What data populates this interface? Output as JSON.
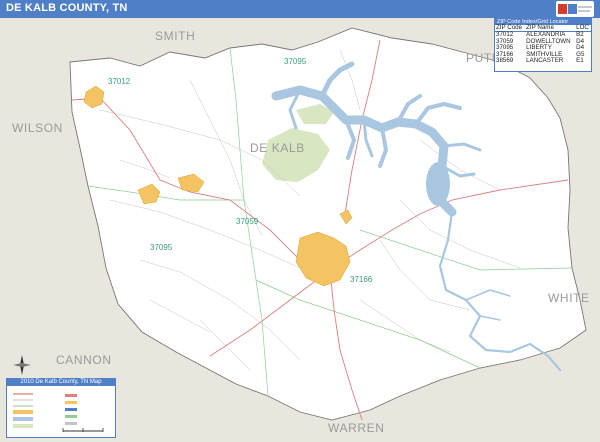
{
  "header": {
    "title": "DE KALB COUNTY, TN"
  },
  "map": {
    "county_name": "DE KALB",
    "neighbors": {
      "north": "SMITH",
      "northeast": "PUTNAM",
      "west": "WILSON",
      "southwest": "CANNON",
      "east": "WHITE",
      "south": "WARREN"
    },
    "zip_labels": [
      "37012",
      "37095",
      "37059",
      "37095",
      "37166"
    ],
    "colors": {
      "county_fill": "#ffffff",
      "outside_fill": "#e9e6dd",
      "water": "#a9c7e0",
      "city": "#f5c462",
      "park": "#d8e6c2",
      "road_major": "#e07f7f",
      "road_minor": "#c4c4c4",
      "zip_boundary": "#8fcf8f",
      "header": "#4f7fc6"
    }
  },
  "zip_table": {
    "title": "ZIP Code Index/Grid Locator",
    "columns": [
      "ZIP Code",
      "ZIP Name",
      "LOC"
    ],
    "rows": [
      [
        "37012",
        "ALEXANDRIA",
        "B2"
      ],
      [
        "37059",
        "DOWELLTOWN",
        "D4"
      ],
      [
        "37095",
        "LIBERTY",
        "D4"
      ],
      [
        "37166",
        "SMITHVILLE",
        "G5"
      ],
      [
        "38569",
        "LANCASTER",
        "E1"
      ]
    ]
  },
  "legend": {
    "title": "2010 De Kalb County, TN Map"
  }
}
